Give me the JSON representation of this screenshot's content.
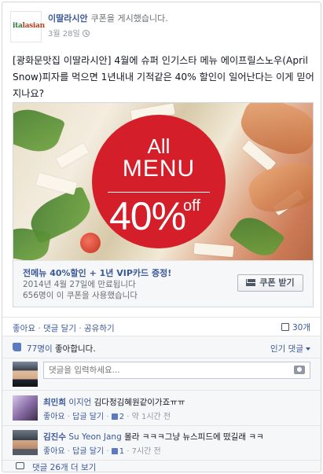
{
  "post": {
    "page_name": "이딸라시안",
    "action": "쿠폰을 게시했습니다.",
    "date": "3월 28일",
    "logo_text_it": "ita",
    "logo_text_rest": "lasian",
    "text": "[광화문맛집 이딸라시안] 4월에 슈퍼 인기스타 메뉴 에이프릴스노우(April Snow)피자를 먹으면 1년내내 기적같은 40% 할인이 일어난다는 이게 믿어지나요?"
  },
  "coupon": {
    "banner_all": "All",
    "banner_menu": "MENU",
    "banner_pct": "40%",
    "banner_off": "off",
    "title": "전메뉴 40%할인 + 1년 VIP카드 증정!",
    "expires": "2014년 4월 27일에 만료됩니다",
    "used": "656명이 이 쿠폰을 사용했습니다",
    "button": "쿠폰 받기"
  },
  "actions": {
    "like": "좋아요",
    "sep": " · ",
    "comment": "댓글 달기",
    "share": "공유하기",
    "share_count": "30개"
  },
  "likes": {
    "count_text": "77명이",
    "suffix": " 좋아합니다.",
    "sort": "인기 댓글"
  },
  "composer": {
    "placeholder": "댓글을 입력하세요..."
  },
  "comments": [
    {
      "author": "최민희",
      "tag": "이지언",
      "text": " 김다정김혜원같이가죠ㅠㅠ",
      "like": "좋아요",
      "reply": "답글 달기",
      "likes": "2",
      "time": "약 1시간 전"
    },
    {
      "author": "김진수",
      "tag": "Su Yeon Jang",
      "text": " 몰라 ㅋㅋㅋ그냥 뉴스피드에 떴길래 ㅋㅋ",
      "like": "좋아요",
      "reply": "답글 달기",
      "likes": "1",
      "time": "7시간 전"
    }
  ],
  "more_comments": "댓글 26개 더 보기",
  "colors": {
    "link": "#3b5998",
    "banner_red": "#d41f2a",
    "meta_gray": "#9197a3"
  }
}
